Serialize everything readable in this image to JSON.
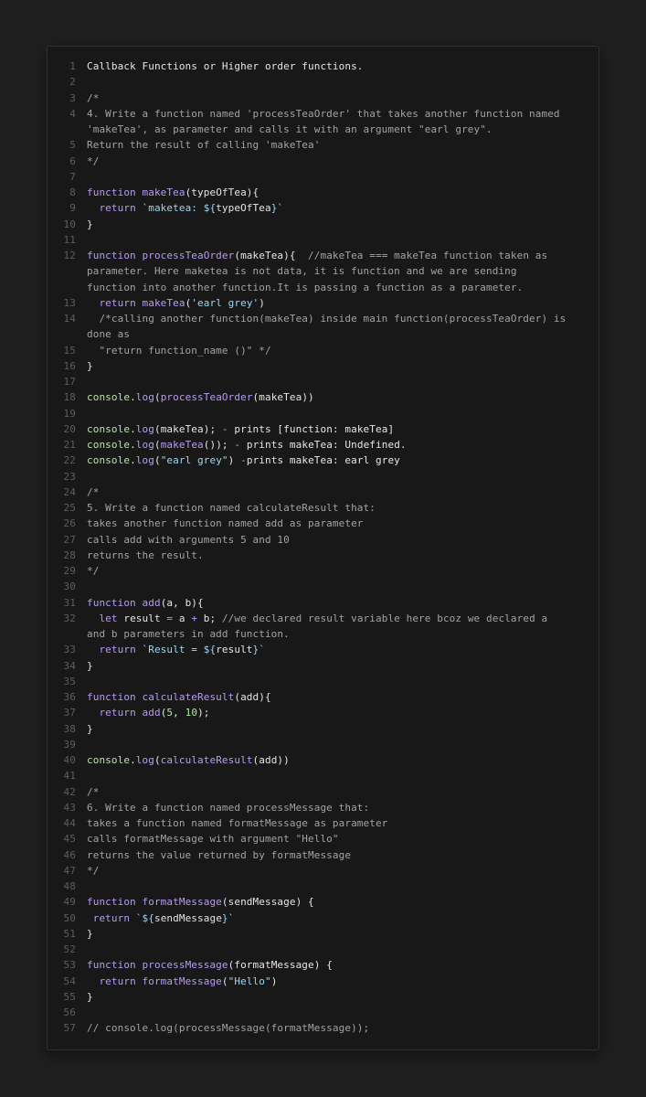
{
  "colors": {
    "background": "#1f1f1f",
    "editor": "#181818",
    "keyword": "#b79cf2",
    "string": "#9fd6f0",
    "number": "#b8e3a9",
    "comment": "#a3a3a3",
    "text": "#e6e6e6",
    "line_number": "#5e5e5e"
  },
  "lines": [
    {
      "n": "1",
      "seg": [
        [
          "plain",
          "Callback Functions or Higher order functions."
        ]
      ]
    },
    {
      "n": "2",
      "seg": []
    },
    {
      "n": "3",
      "seg": [
        [
          "cmt",
          "/*"
        ]
      ]
    },
    {
      "n": "4",
      "seg": [
        [
          "cmt",
          "4. Write a function named 'processTeaOrder' that takes another function named"
        ]
      ]
    },
    {
      "n": "",
      "seg": [
        [
          "cmt",
          "'makeTea', as parameter and calls it with an argument \"earl grey\"."
        ]
      ]
    },
    {
      "n": "5",
      "seg": [
        [
          "cmt",
          "Return the result of calling 'makeTea'"
        ]
      ]
    },
    {
      "n": "6",
      "seg": [
        [
          "cmt",
          "*/"
        ]
      ]
    },
    {
      "n": "7",
      "seg": []
    },
    {
      "n": "8",
      "seg": [
        [
          "kw",
          "function "
        ],
        [
          "fn",
          "makeTea"
        ],
        [
          "plain",
          "(typeOfTea){"
        ]
      ]
    },
    {
      "n": "9",
      "seg": [
        [
          "plain",
          "  "
        ],
        [
          "kw",
          "return "
        ],
        [
          "str",
          "`maketea: ${"
        ],
        [
          "plain",
          "typeOfTea"
        ],
        [
          "str",
          "}`"
        ]
      ]
    },
    {
      "n": "10",
      "seg": [
        [
          "plain",
          "}"
        ]
      ]
    },
    {
      "n": "11",
      "seg": []
    },
    {
      "n": "12",
      "seg": [
        [
          "kw",
          "function "
        ],
        [
          "fn",
          "processTeaOrder"
        ],
        [
          "plain",
          "(makeTea){  "
        ],
        [
          "cmt",
          "//makeTea === makeTea function taken as"
        ]
      ]
    },
    {
      "n": "",
      "seg": [
        [
          "cmt",
          "parameter. Here maketea is not data, it is function and we are sending"
        ]
      ]
    },
    {
      "n": "",
      "seg": [
        [
          "cmt",
          "function into another function.It is passing a function as a parameter."
        ]
      ]
    },
    {
      "n": "13",
      "seg": [
        [
          "plain",
          "  "
        ],
        [
          "kw",
          "return "
        ],
        [
          "fn",
          "makeTea"
        ],
        [
          "plain",
          "("
        ],
        [
          "str",
          "'earl grey'"
        ],
        [
          "plain",
          ")"
        ]
      ]
    },
    {
      "n": "14",
      "seg": [
        [
          "cmt",
          "  /*calling another function(makeTea) inside main function(processTeaOrder) is"
        ]
      ]
    },
    {
      "n": "",
      "seg": [
        [
          "cmt",
          "done as"
        ]
      ]
    },
    {
      "n": "15",
      "seg": [
        [
          "cmt",
          "  \"return function_name ()\" */"
        ]
      ]
    },
    {
      "n": "16",
      "seg": [
        [
          "plain",
          "}"
        ]
      ]
    },
    {
      "n": "17",
      "seg": []
    },
    {
      "n": "18",
      "seg": [
        [
          "con",
          "console"
        ],
        [
          "plain",
          "."
        ],
        [
          "fn",
          "log"
        ],
        [
          "plain",
          "("
        ],
        [
          "fn",
          "processTeaOrder"
        ],
        [
          "plain",
          "(makeTea))"
        ]
      ]
    },
    {
      "n": "19",
      "seg": []
    },
    {
      "n": "20",
      "seg": [
        [
          "con",
          "console"
        ],
        [
          "plain",
          "."
        ],
        [
          "fn",
          "log"
        ],
        [
          "plain",
          "(makeTea); "
        ],
        [
          "op",
          "-"
        ],
        [
          "plain",
          " prints [function: makeTea]"
        ]
      ]
    },
    {
      "n": "21",
      "seg": [
        [
          "con",
          "console"
        ],
        [
          "plain",
          "."
        ],
        [
          "fn",
          "log"
        ],
        [
          "plain",
          "("
        ],
        [
          "fn",
          "makeTea"
        ],
        [
          "plain",
          "()); "
        ],
        [
          "op",
          "-"
        ],
        [
          "plain",
          " prints makeTea: Undefined."
        ]
      ]
    },
    {
      "n": "22",
      "seg": [
        [
          "con",
          "console"
        ],
        [
          "plain",
          "."
        ],
        [
          "fn",
          "log"
        ],
        [
          "plain",
          "("
        ],
        [
          "str",
          "\"earl grey\""
        ],
        [
          "plain",
          ") "
        ],
        [
          "op",
          "-"
        ],
        [
          "plain",
          "prints makeTea: earl grey"
        ]
      ]
    },
    {
      "n": "23",
      "seg": []
    },
    {
      "n": "24",
      "seg": [
        [
          "cmt",
          "/*"
        ]
      ]
    },
    {
      "n": "25",
      "seg": [
        [
          "cmt",
          "5. Write a function named calculateResult that:"
        ]
      ]
    },
    {
      "n": "26",
      "seg": [
        [
          "cmt",
          "takes another function named add as parameter"
        ]
      ]
    },
    {
      "n": "27",
      "seg": [
        [
          "cmt",
          "calls add with arguments 5 and 10"
        ]
      ]
    },
    {
      "n": "28",
      "seg": [
        [
          "cmt",
          "returns the result."
        ]
      ]
    },
    {
      "n": "29",
      "seg": [
        [
          "cmt",
          "*/"
        ]
      ]
    },
    {
      "n": "30",
      "seg": []
    },
    {
      "n": "31",
      "seg": [
        [
          "kw",
          "function "
        ],
        [
          "fn",
          "add"
        ],
        [
          "plain",
          "(a, b){"
        ]
      ]
    },
    {
      "n": "32",
      "seg": [
        [
          "plain",
          "  "
        ],
        [
          "kw",
          "let "
        ],
        [
          "plain",
          "result "
        ],
        [
          "op",
          "="
        ],
        [
          "plain",
          " a "
        ],
        [
          "op",
          "+"
        ],
        [
          "plain",
          " b; "
        ],
        [
          "cmt",
          "//we declared result variable here bcoz we declared a"
        ]
      ]
    },
    {
      "n": "",
      "seg": [
        [
          "cmt",
          "and b parameters in add function."
        ]
      ]
    },
    {
      "n": "33",
      "seg": [
        [
          "plain",
          "  "
        ],
        [
          "kw",
          "return "
        ],
        [
          "str",
          "`Result = ${"
        ],
        [
          "plain",
          "result"
        ],
        [
          "str",
          "}`"
        ]
      ]
    },
    {
      "n": "34",
      "seg": [
        [
          "plain",
          "}"
        ]
      ]
    },
    {
      "n": "35",
      "seg": []
    },
    {
      "n": "36",
      "seg": [
        [
          "kw",
          "function "
        ],
        [
          "fn",
          "calculateResult"
        ],
        [
          "plain",
          "(add){"
        ]
      ]
    },
    {
      "n": "37",
      "seg": [
        [
          "plain",
          "  "
        ],
        [
          "kw",
          "return "
        ],
        [
          "fn",
          "add"
        ],
        [
          "plain",
          "("
        ],
        [
          "num",
          "5"
        ],
        [
          "plain",
          ", "
        ],
        [
          "num",
          "10"
        ],
        [
          "plain",
          ");"
        ]
      ]
    },
    {
      "n": "38",
      "seg": [
        [
          "plain",
          "}"
        ]
      ]
    },
    {
      "n": "39",
      "seg": []
    },
    {
      "n": "40",
      "seg": [
        [
          "con",
          "console"
        ],
        [
          "plain",
          "."
        ],
        [
          "fn",
          "log"
        ],
        [
          "plain",
          "("
        ],
        [
          "fn",
          "calculateResult"
        ],
        [
          "plain",
          "(add))"
        ]
      ]
    },
    {
      "n": "41",
      "seg": []
    },
    {
      "n": "42",
      "seg": [
        [
          "cmt",
          "/*"
        ]
      ]
    },
    {
      "n": "43",
      "seg": [
        [
          "cmt",
          "6. Write a function named processMessage that:"
        ]
      ]
    },
    {
      "n": "44",
      "seg": [
        [
          "cmt",
          "takes a function named formatMessage as parameter"
        ]
      ]
    },
    {
      "n": "45",
      "seg": [
        [
          "cmt",
          "calls formatMessage with argument \"Hello\""
        ]
      ]
    },
    {
      "n": "46",
      "seg": [
        [
          "cmt",
          "returns the value returned by formatMessage"
        ]
      ]
    },
    {
      "n": "47",
      "seg": [
        [
          "cmt",
          "*/"
        ]
      ]
    },
    {
      "n": "48",
      "seg": []
    },
    {
      "n": "49",
      "seg": [
        [
          "kw",
          "function "
        ],
        [
          "fn",
          "formatMessage"
        ],
        [
          "plain",
          "(sendMessage) {"
        ]
      ]
    },
    {
      "n": "50",
      "seg": [
        [
          "plain",
          " "
        ],
        [
          "kw",
          "return "
        ],
        [
          "str",
          "`${"
        ],
        [
          "plain",
          "sendMessage"
        ],
        [
          "str",
          "}`"
        ]
      ]
    },
    {
      "n": "51",
      "seg": [
        [
          "plain",
          "}"
        ]
      ]
    },
    {
      "n": "52",
      "seg": []
    },
    {
      "n": "53",
      "seg": [
        [
          "kw",
          "function "
        ],
        [
          "fn",
          "processMessage"
        ],
        [
          "plain",
          "(formatMessage) {"
        ]
      ]
    },
    {
      "n": "54",
      "seg": [
        [
          "plain",
          "  "
        ],
        [
          "kw",
          "return "
        ],
        [
          "fn",
          "formatMessage"
        ],
        [
          "plain",
          "("
        ],
        [
          "str",
          "\"Hello\""
        ],
        [
          "plain",
          ")"
        ]
      ]
    },
    {
      "n": "55",
      "seg": [
        [
          "plain",
          "}"
        ]
      ]
    },
    {
      "n": "56",
      "seg": []
    },
    {
      "n": "57",
      "seg": [
        [
          "cmt",
          "// console.log(processMessage(formatMessage));"
        ]
      ]
    }
  ]
}
